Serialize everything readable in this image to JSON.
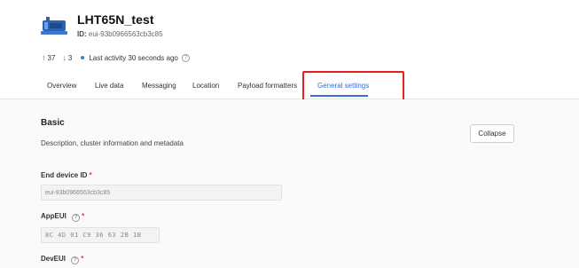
{
  "device": {
    "title": "LHT65N_test",
    "id_label": "ID:",
    "id_value": "eui-93b0966563cb3c85"
  },
  "stats": {
    "uplink_count": "37",
    "downlink_count": "3",
    "last_activity": "Last activity 30 seconds ago"
  },
  "tabs": [
    {
      "label": "Overview"
    },
    {
      "label": "Live data"
    },
    {
      "label": "Messaging"
    },
    {
      "label": "Location"
    },
    {
      "label": "Payload formatters"
    },
    {
      "label": "General settings",
      "active": true
    }
  ],
  "section": {
    "title": "Basic",
    "description": "Description, cluster information and metadata",
    "collapse_label": "Collapse"
  },
  "fields": {
    "end_device_id": {
      "label": "End device ID",
      "value": "eui-93b0966563cb3c85"
    },
    "app_eui": {
      "label": "AppEUI",
      "value": "8C 4D 01 C9 36 63 2B 1B"
    },
    "dev_eui": {
      "label": "DevEUI"
    }
  },
  "colors": {
    "accent": "#3b6fd3",
    "highlight": "#e8201c",
    "required": "#d23a3a"
  },
  "icons": {
    "device": "device-icon",
    "uplink": "arrow-up-icon",
    "downlink": "arrow-down-icon",
    "status": "status-dot-icon",
    "help": "help-icon"
  }
}
